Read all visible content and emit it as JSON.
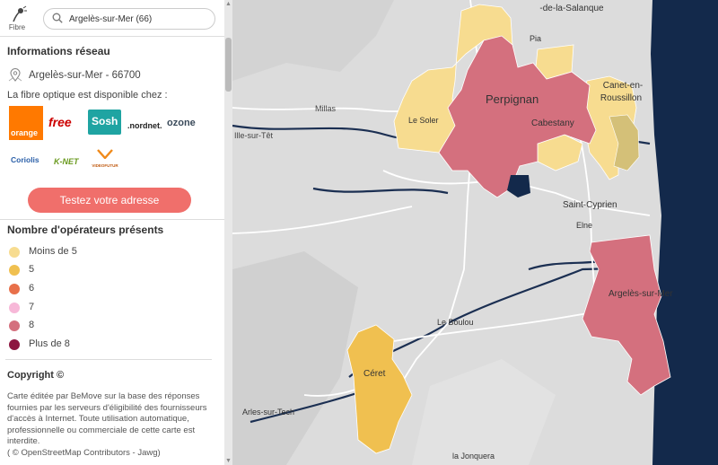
{
  "header": {
    "logo_label": "Fibre",
    "search_value": "Argelès-sur-Mer (66)"
  },
  "network_info": {
    "title": "Informations réseau",
    "location": "Argelès-sur-Mer - 66700",
    "availability_text": "La fibre optique est disponible chez :",
    "operators": [
      "orange",
      "free",
      "Sosh",
      ".nordnet.",
      "ozone",
      "Coriolis",
      "K-NET",
      "VIDEOFUTUR"
    ],
    "cta_label": "Testez votre adresse"
  },
  "legend": {
    "title": "Nombre d'opérateurs présents",
    "items": [
      {
        "label": "Moins de 5",
        "color": "#f7dc90"
      },
      {
        "label": "5",
        "color": "#f0c050"
      },
      {
        "label": "6",
        "color": "#e8704a"
      },
      {
        "label": "7",
        "color": "#f7b8d8"
      },
      {
        "label": "8",
        "color": "#d4707e"
      },
      {
        "label": "Plus de 8",
        "color": "#8c1540"
      }
    ]
  },
  "copyright": {
    "title": "Copyright ©",
    "text": "Carte éditée par BeMove sur la base des réponses fournies par les serveurs d'éligibilité des fournisseurs d'accès à Internet. Toute utilisation automatique, professionnelle ou commerciale de cette carte est interdite.",
    "credit": "( © OpenStreetMap Contributors - Jawg)"
  },
  "map": {
    "labels": {
      "salanque": "-de-la-Salanque",
      "pia": "Pia",
      "perpignan": "Perpignan",
      "canet": "Canet-en-",
      "roussillon": "Roussillon",
      "millas": "Millas",
      "lesoler": "Le Soler",
      "cabestany": "Cabestany",
      "illesurtet": "Ille-sur-Têt",
      "stcyprien": "Saint-Cyprien",
      "elne": "Elne",
      "argeles": "Argelès-sur-Mer",
      "leboulou": "Le Boulou",
      "ceret": "Céret",
      "arles": "Arles-sur-Tech",
      "lajonquera": "la Jonquera"
    },
    "colors": {
      "land": "#dcdcdc",
      "sea": "#13294b",
      "road": "#ffffff"
    }
  }
}
